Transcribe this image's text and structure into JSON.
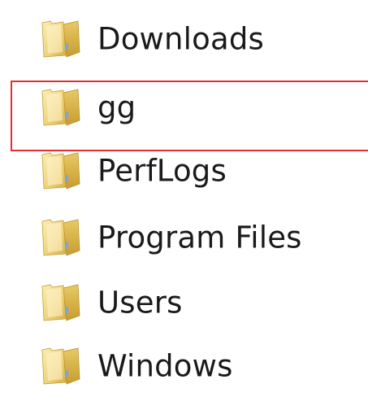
{
  "folders": [
    {
      "name": "Downloads",
      "icon": "folder-icon"
    },
    {
      "name": "gg",
      "icon": "folder-icon"
    },
    {
      "name": "PerfLogs",
      "icon": "folder-icon"
    },
    {
      "name": "Program Files",
      "icon": "folder-icon"
    },
    {
      "name": "Users",
      "icon": "folder-icon"
    },
    {
      "name": "Windows",
      "icon": "folder-icon"
    }
  ],
  "highlighted_folder": "gg",
  "colors": {
    "highlight_border": "#e52d2d",
    "folder_light": "#f3dd8d",
    "folder_mid": "#e3c35e",
    "folder_dark": "#c9a233",
    "text": "#1a1a1a"
  }
}
